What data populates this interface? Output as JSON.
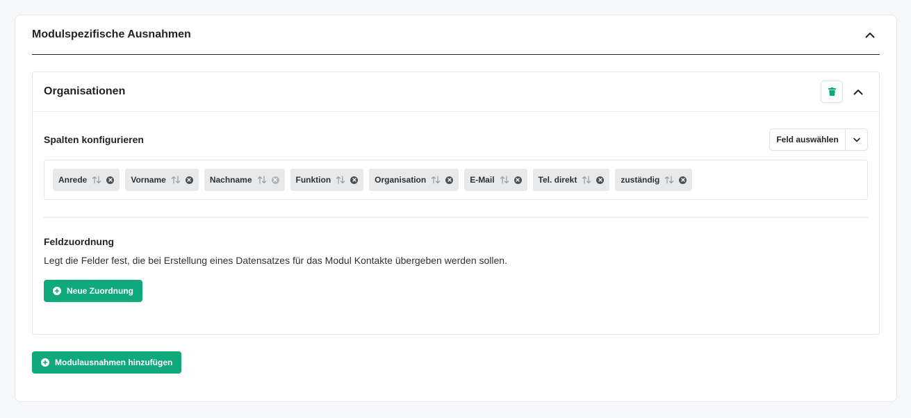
{
  "section": {
    "title": "Modulspezifische Ausnahmen"
  },
  "module_card": {
    "title": "Organisationen",
    "columns_label": "Spalten konfigurieren",
    "field_select_label": "Feld auswählen",
    "chips": [
      {
        "label": "Anrede",
        "removable": true
      },
      {
        "label": "Vorname",
        "removable": true
      },
      {
        "label": "Nachname",
        "removable": false
      },
      {
        "label": "Funktion",
        "removable": true
      },
      {
        "label": "Organisation",
        "removable": true
      },
      {
        "label": "E-Mail",
        "removable": true
      },
      {
        "label": "Tel. direkt",
        "removable": true
      },
      {
        "label": "zuständig",
        "removable": true
      }
    ],
    "mapping_title": "Feldzuordnung",
    "mapping_description": "Legt die Felder fest, die bei Erstellung eines Datensatzes für das Modul Kontakte übergeben werden sollen.",
    "new_mapping_label": "Neue Zuordnung"
  },
  "add_exceptions_label": "Modulausnahmen hinzufügen",
  "colors": {
    "accent": "#0fa97b",
    "chip_bg": "#e8e9eb",
    "border": "#e4e6ea"
  }
}
